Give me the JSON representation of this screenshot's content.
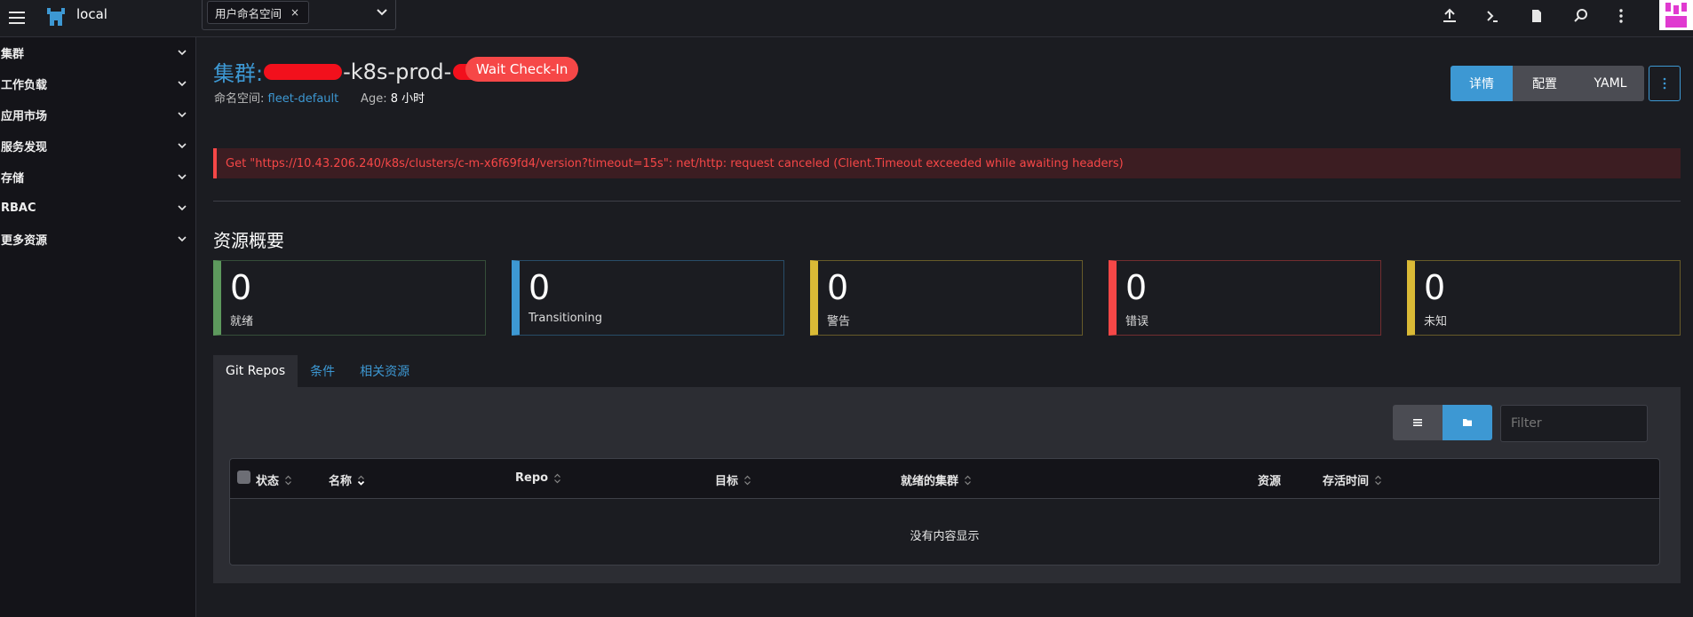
{
  "header": {
    "cluster_name": "local",
    "namespace_chip": "用户命名空间",
    "chip_close": "×"
  },
  "sidebar": {
    "items": [
      {
        "label": "集群"
      },
      {
        "label": "工作负载"
      },
      {
        "label": "应用市场"
      },
      {
        "label": "服务发现"
      },
      {
        "label": "存储"
      },
      {
        "label": "RBAC"
      },
      {
        "label": "更多资源"
      }
    ]
  },
  "page": {
    "title_prefix": "集群:",
    "title_mid": "-k8s-prod-",
    "badge": "Wait Check-In",
    "namespace_label": "命名空间:",
    "namespace_value": "fleet-default",
    "age_label": "Age:",
    "age_value": "8 小时",
    "actions": {
      "detail": "详情",
      "config": "配置",
      "yaml": "YAML"
    },
    "error": "Get \"https://10.43.206.240/k8s/clusters/c-m-x6f69fd4/version?timeout=15s\": net/http: request canceled (Client.Timeout exceeded while awaiting headers)",
    "section_title": "资源概要"
  },
  "cards": [
    {
      "value": "0",
      "label": "就绪",
      "color": "#5d995d"
    },
    {
      "value": "0",
      "label": "Transitioning",
      "color": "#3d98d3"
    },
    {
      "value": "0",
      "label": "警告",
      "color": "#daba36"
    },
    {
      "value": "0",
      "label": "错误",
      "color": "#f64747"
    },
    {
      "value": "0",
      "label": "未知",
      "color": "#daba36"
    }
  ],
  "tabs": [
    {
      "label": "Git Repos"
    },
    {
      "label": "条件"
    },
    {
      "label": "相关资源"
    }
  ],
  "table": {
    "filter_placeholder": "Filter",
    "columns": {
      "status": "状态",
      "name": "名称",
      "repo": "Repo",
      "target": "目标",
      "ready_clusters": "就绪的集群",
      "resources": "资源",
      "age": "存活时间"
    },
    "empty_text": "没有内容显示"
  },
  "colors": {
    "accent": "#3d98d3",
    "error": "#f64747",
    "background": "#1b1c21"
  }
}
